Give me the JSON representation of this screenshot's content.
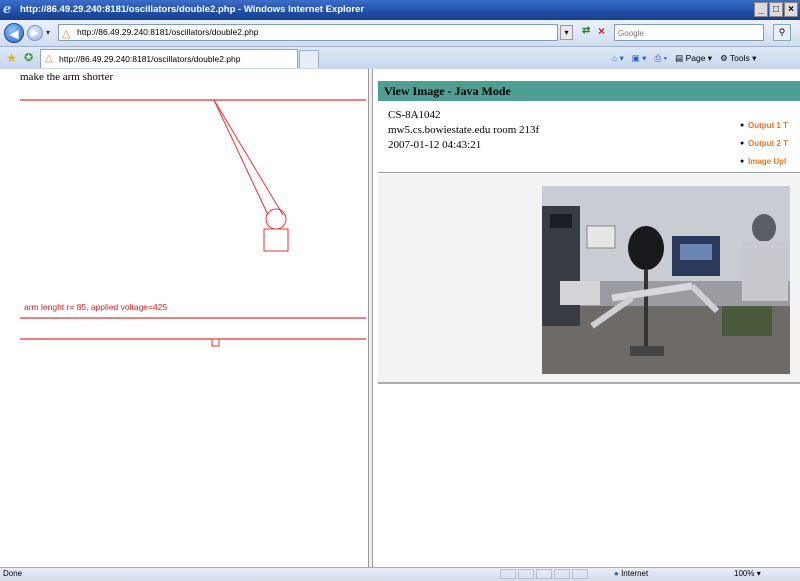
{
  "window": {
    "title": "http://86.49.29.240:8181/oscillators/double2.php - Windows Internet Explorer",
    "minimize": "_",
    "maximize": "□",
    "close": "×"
  },
  "address_bar": {
    "url": "http://86.49.29.240:8181/oscillators/double2.php",
    "search_placeholder": "Google"
  },
  "tab": {
    "label": "http://86.49.29.240:8181/oscillators/double2.php"
  },
  "command_bar": {
    "page_label": "Page",
    "tools_label": "Tools"
  },
  "left_frame": {
    "instruction": "make the arm shorter",
    "arm_info": "arm lenght r= 85,  applied voltage=425"
  },
  "right_frame": {
    "header": "View Image - Java Mode",
    "device_id": "CS-8A1042",
    "host": "mw5.cs.bowiestate.edu room 213f",
    "timestamp": "2007-01-12 04:43:21",
    "links": [
      "Output 1 T",
      "Output 2 T",
      "Image Upl"
    ]
  },
  "status_bar": {
    "status": "Done",
    "zone": "Internet",
    "zoom": "100%"
  },
  "colors": {
    "pendulum": "#e83030",
    "header_bg": "#4d9f92",
    "link": "#e8781e",
    "titlebar": "#1e4ea8"
  },
  "icons": [
    "ie-logo-icon",
    "back-arrow-icon",
    "forward-arrow-icon",
    "page-icon",
    "refresh-icon",
    "stop-icon",
    "search-icon",
    "favorites-star-icon",
    "add-favorites-icon",
    "home-icon",
    "feeds-icon",
    "print-icon",
    "page-menu-icon",
    "tools-icon",
    "globe-icon"
  ]
}
